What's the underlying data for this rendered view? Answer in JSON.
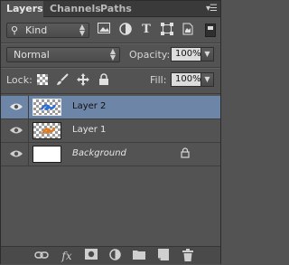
{
  "tabs": [
    {
      "label": "Layers",
      "active": true
    },
    {
      "label": "Channels",
      "active": false
    },
    {
      "label": "Paths",
      "active": false
    }
  ],
  "panel_menu_icon": "panel-menu-icon",
  "filter": {
    "kind_label": "Kind",
    "icons": [
      "pixel-layer-filter-icon",
      "adjustment-layer-filter-icon",
      "type-layer-filter-icon",
      "shape-layer-filter-icon",
      "smart-object-filter-icon"
    ],
    "toggle_on": true
  },
  "blend_mode": "Normal",
  "opacity": {
    "label": "Opacity:",
    "value": "100%"
  },
  "lock": {
    "label": "Lock:",
    "icons": [
      "lock-transparent-pixels-icon",
      "lock-image-pixels-icon",
      "lock-position-icon",
      "lock-all-icon"
    ]
  },
  "fill": {
    "label": "Fill:",
    "value": "100%"
  },
  "layers": [
    {
      "name": "Layer 2",
      "visible": true,
      "selected": true,
      "italic": false,
      "locked": false,
      "thumb": "transparent-with-blue-art"
    },
    {
      "name": "Layer 1",
      "visible": true,
      "selected": false,
      "italic": false,
      "locked": false,
      "thumb": "transparent-with-orange-art"
    },
    {
      "name": "Background",
      "visible": true,
      "selected": false,
      "italic": true,
      "locked": true,
      "thumb": "white"
    }
  ],
  "bottom_icons": [
    "link-layers-icon",
    "add-layer-style-icon",
    "add-layer-mask-icon",
    "new-adjustment-layer-icon",
    "new-group-icon",
    "new-layer-icon",
    "delete-layer-icon"
  ],
  "colors": {
    "panel_bg": "#535353",
    "selected_row": "#6d85a6",
    "tab_bar": "#3a3a3a"
  }
}
